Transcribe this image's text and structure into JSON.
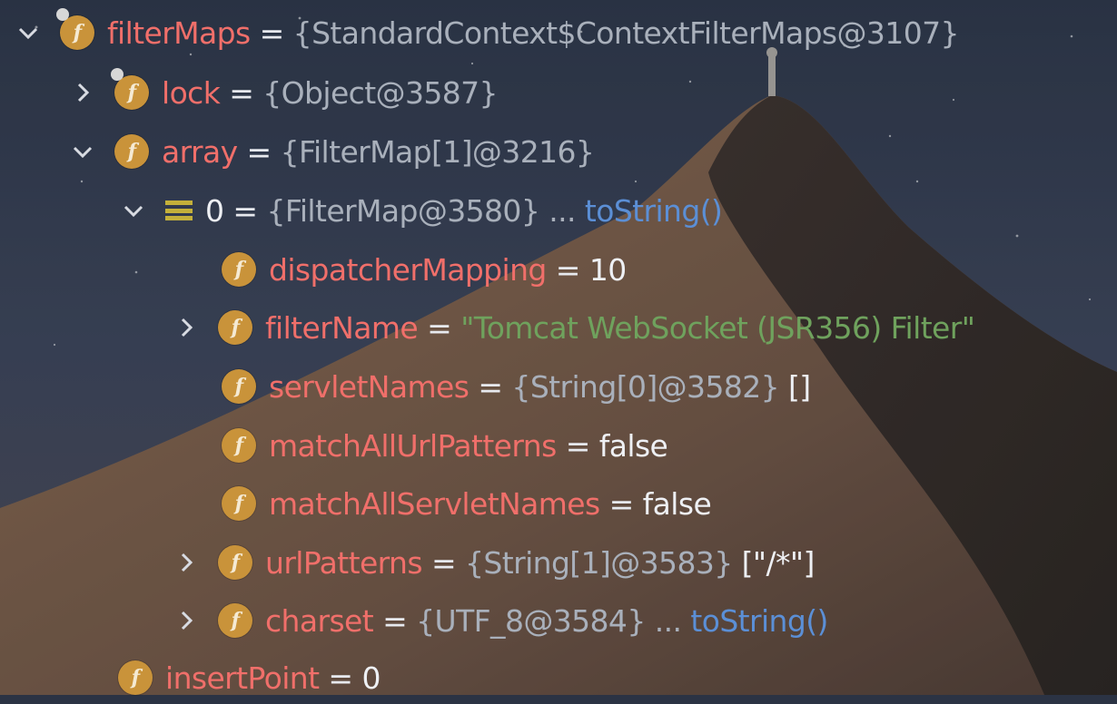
{
  "colors": {
    "field_name": "#f06f6a",
    "reference": "#a9b0bb",
    "string_value": "#6fa25d",
    "link": "#5b8fd6",
    "badge": "#c9933a",
    "array_icon": "#c4b03a"
  },
  "rows": [
    {
      "name": "filterMaps",
      "eq": "=",
      "ref": "{StandardContext$ContextFilterMaps@3107}"
    },
    {
      "name": "lock",
      "eq": "=",
      "ref": "{Object@3587}"
    },
    {
      "name": "array",
      "eq": "=",
      "ref": "{FilterMap[1]@3216}"
    },
    {
      "name": "0",
      "eq": "=",
      "ref": "{FilterMap@3580}",
      "dots": "...",
      "link": "toString()"
    },
    {
      "name": "dispatcherMapping",
      "eq": "=",
      "value": "10"
    },
    {
      "name": "filterName",
      "eq": "=",
      "value": "\"Tomcat WebSocket (JSR356) Filter\""
    },
    {
      "name": "servletNames",
      "eq": "=",
      "ref": "{String[0]@3582}",
      "value": "[]"
    },
    {
      "name": "matchAllUrlPatterns",
      "eq": "=",
      "value": "false"
    },
    {
      "name": "matchAllServletNames",
      "eq": "=",
      "value": "false"
    },
    {
      "name": "urlPatterns",
      "eq": "=",
      "ref": "{String[1]@3583}",
      "value": "[\"/*\"]"
    },
    {
      "name": "charset",
      "eq": "=",
      "ref": "{UTF_8@3584}",
      "dots": "...",
      "link": "toString()"
    },
    {
      "name": "insertPoint",
      "eq": "=",
      "value": "0"
    }
  ],
  "icons": {
    "field": "f",
    "expand": "chevron-down-icon",
    "collapse": "chevron-right-icon",
    "array": "array-icon"
  }
}
